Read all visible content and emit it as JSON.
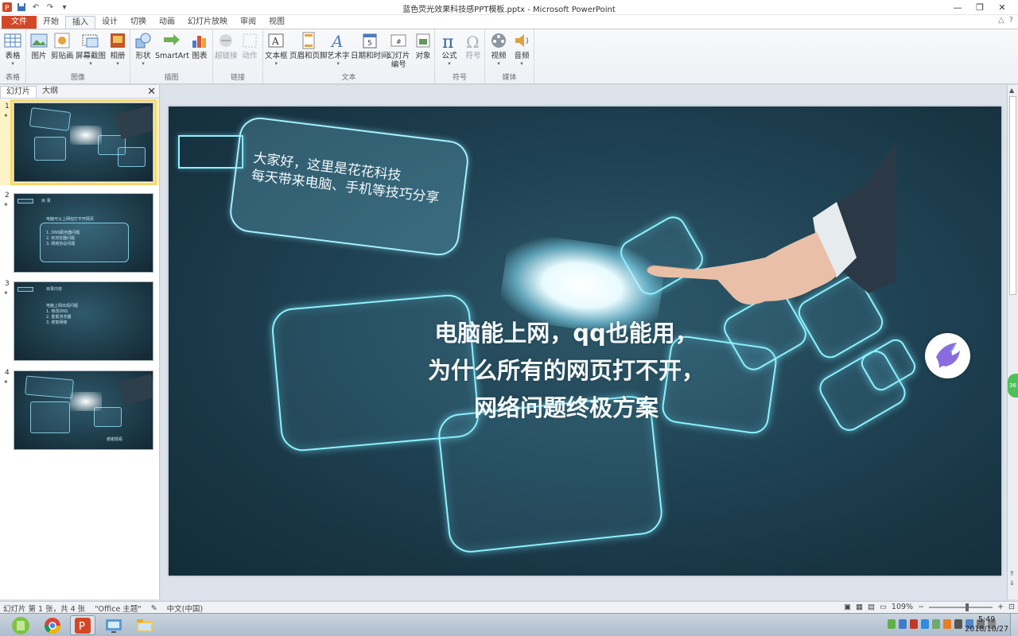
{
  "window": {
    "title": "蓝色荧光效果科技感PPT模板.pptx - Microsoft PowerPoint",
    "minimize": "—",
    "maximize": "❐",
    "close": "✕"
  },
  "qat": {
    "save": "💾",
    "undo": "↶",
    "redo": "↷",
    "customize": "▾"
  },
  "tabs": [
    {
      "label": "文件"
    },
    {
      "label": "开始"
    },
    {
      "label": "插入"
    },
    {
      "label": "设计"
    },
    {
      "label": "切换"
    },
    {
      "label": "动画"
    },
    {
      "label": "幻灯片放映"
    },
    {
      "label": "审阅"
    },
    {
      "label": "视图"
    }
  ],
  "ribbon_right": {
    "collapse": "△",
    "help": "?"
  },
  "ribbon": {
    "groups": [
      {
        "label": "表格"
      },
      {
        "label": "图像"
      },
      {
        "label": "插图"
      },
      {
        "label": "链接"
      },
      {
        "label": "文本"
      },
      {
        "label": "符号"
      },
      {
        "label": "媒体"
      }
    ],
    "buttons": {
      "table": "表格",
      "picture": "图片",
      "clipart": "剪贴画",
      "screenshot": "屏幕截图",
      "album": "相册",
      "shapes": "形状",
      "smartart": "SmartArt",
      "chart": "图表",
      "hyperlink": "超链接",
      "action": "动作",
      "textbox": "文本框",
      "header_footer": "页眉和页脚",
      "wordart": "艺术字",
      "datetime": "日期和时间",
      "slide_number_1": "幻灯片",
      "slide_number_2": "编号",
      "object": "对象",
      "equation": "公式",
      "symbol": "符号",
      "video": "视频",
      "audio": "音频"
    }
  },
  "pane": {
    "tab_slides": "幻灯片",
    "tab_outline": "大纲",
    "close": "✕",
    "thumbs": [
      {
        "num": "1"
      },
      {
        "num": "2",
        "title": "目 录",
        "line1": "电脑可以上网但打不开网页",
        "line2": "1. DNS服务器问题",
        "line3": "2. IE浏览器问题",
        "line4": "3. 网络协议问题"
      },
      {
        "num": "3",
        "title": "目录内容",
        "line1": "电脑上网出现问题",
        "line2": "1. 修改DNS",
        "line3": "2. 重置浏览器",
        "line4": "3. 修复网络"
      },
      {
        "num": "4",
        "thanks": "谢谢观看"
      }
    ]
  },
  "slide": {
    "greeting_line1": "大家好，这里是花花科技",
    "greeting_line2": "每天带来电脑、手机等技巧分享",
    "title_line1": "电脑能上网，qq也能用，",
    "title_line2": "为什么所有的网页打不开，",
    "title_line3": "网络问题终极方案"
  },
  "status": {
    "slide_info": "幻灯片 第 1 张，共 4 张",
    "theme": "\"Office 主题\"",
    "language": "中文(中国)",
    "zoom": "109%",
    "zoom_minus": "−",
    "zoom_plus": "+"
  },
  "taskbar": {
    "time": "5:49",
    "date": "2018/10/27"
  },
  "side_badge": "36"
}
